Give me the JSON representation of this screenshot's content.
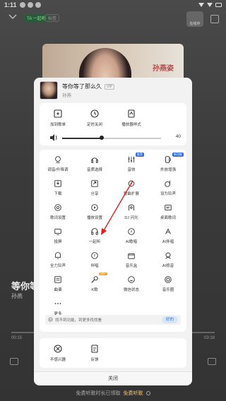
{
  "status_bar": {
    "time": "1:11"
  },
  "player_bg": {
    "tag": "TA 一起听",
    "tag2": "标签",
    "album_text": "孙燕姿",
    "avatar_caption": "在线中",
    "song_title": "等你等了那么久",
    "singer": "孙燕",
    "time_start": "00:15",
    "time_end": "03:18",
    "bottom_text": "免费听歌时长已领取",
    "bottom_link": "免费听歌"
  },
  "panel": {
    "song_title": "等你等了那么久",
    "vip_tag": "VIP",
    "singer": "孙燕",
    "top_row": [
      {
        "label": "加到歌单",
        "icon": "playlist-add-icon"
      },
      {
        "label": "定时关闭",
        "icon": "timer-icon"
      },
      {
        "label": "播放器样式",
        "icon": "player-style-icon"
      }
    ],
    "volume": {
      "value": 40,
      "label": "40",
      "percent": 0.4
    },
    "grid": [
      {
        "label": "调音/升降调",
        "icon": "tune-icon"
      },
      {
        "label": "音质选择",
        "icon": "quality-icon"
      },
      {
        "label": "音效",
        "icon": "equalizer-icon",
        "badge": "推荐"
      },
      {
        "label": "外放增强",
        "icon": "speaker-boost-icon",
        "badge": "新功能"
      },
      {
        "label": "下载",
        "icon": "download-icon"
      },
      {
        "label": "分享",
        "icon": "share-icon"
      },
      {
        "label": "歌曲扩展",
        "icon": "song-extend-icon"
      },
      {
        "label": "设为铃声",
        "icon": "ringtone-icon"
      },
      {
        "label": "歌词设置",
        "icon": "lyrics-settings-icon"
      },
      {
        "label": "播放设置",
        "icon": "play-settings-icon"
      },
      {
        "label": "DJ 闪光",
        "icon": "dj-icon"
      },
      {
        "label": "桌面歌词",
        "icon": "desktop-lyrics-icon"
      },
      {
        "label": "投屏",
        "icon": "cast-icon"
      },
      {
        "label": "一起听",
        "icon": "listen-together-icon"
      },
      {
        "label": "AI歌唱",
        "icon": "ai-sing-icon"
      },
      {
        "label": "AI伴唱",
        "icon": "ai-harmony-icon"
      },
      {
        "label": "全力铃声",
        "icon": "bell-icon"
      },
      {
        "label": "伴唱",
        "icon": "accompany-icon"
      },
      {
        "label": "音乐盒",
        "icon": "music-box-icon"
      },
      {
        "label": "AI修音",
        "icon": "ai-tune-icon"
      },
      {
        "label": "曲谱",
        "icon": "score-icon"
      },
      {
        "label": "K歌",
        "icon": "karaoke-icon",
        "badge": "999+"
      },
      {
        "label": "微信状态",
        "icon": "wechat-status-icon"
      },
      {
        "label": "音乐圈",
        "icon": "music-circle-icon"
      },
      {
        "label": "更多",
        "icon": "more-icon"
      }
    ],
    "tip": {
      "text": "找不到功能，到更多找找看",
      "button": "好的"
    },
    "bottom_row": [
      {
        "label": "不感兴趣",
        "icon": "not-interested-icon"
      },
      {
        "label": "反馈",
        "icon": "feedback-icon"
      }
    ],
    "close_label": "关闭"
  },
  "colors": {
    "accent": "#2d6cdf",
    "arrow": "#e02020",
    "panel_bg": "#f2f2f2"
  }
}
